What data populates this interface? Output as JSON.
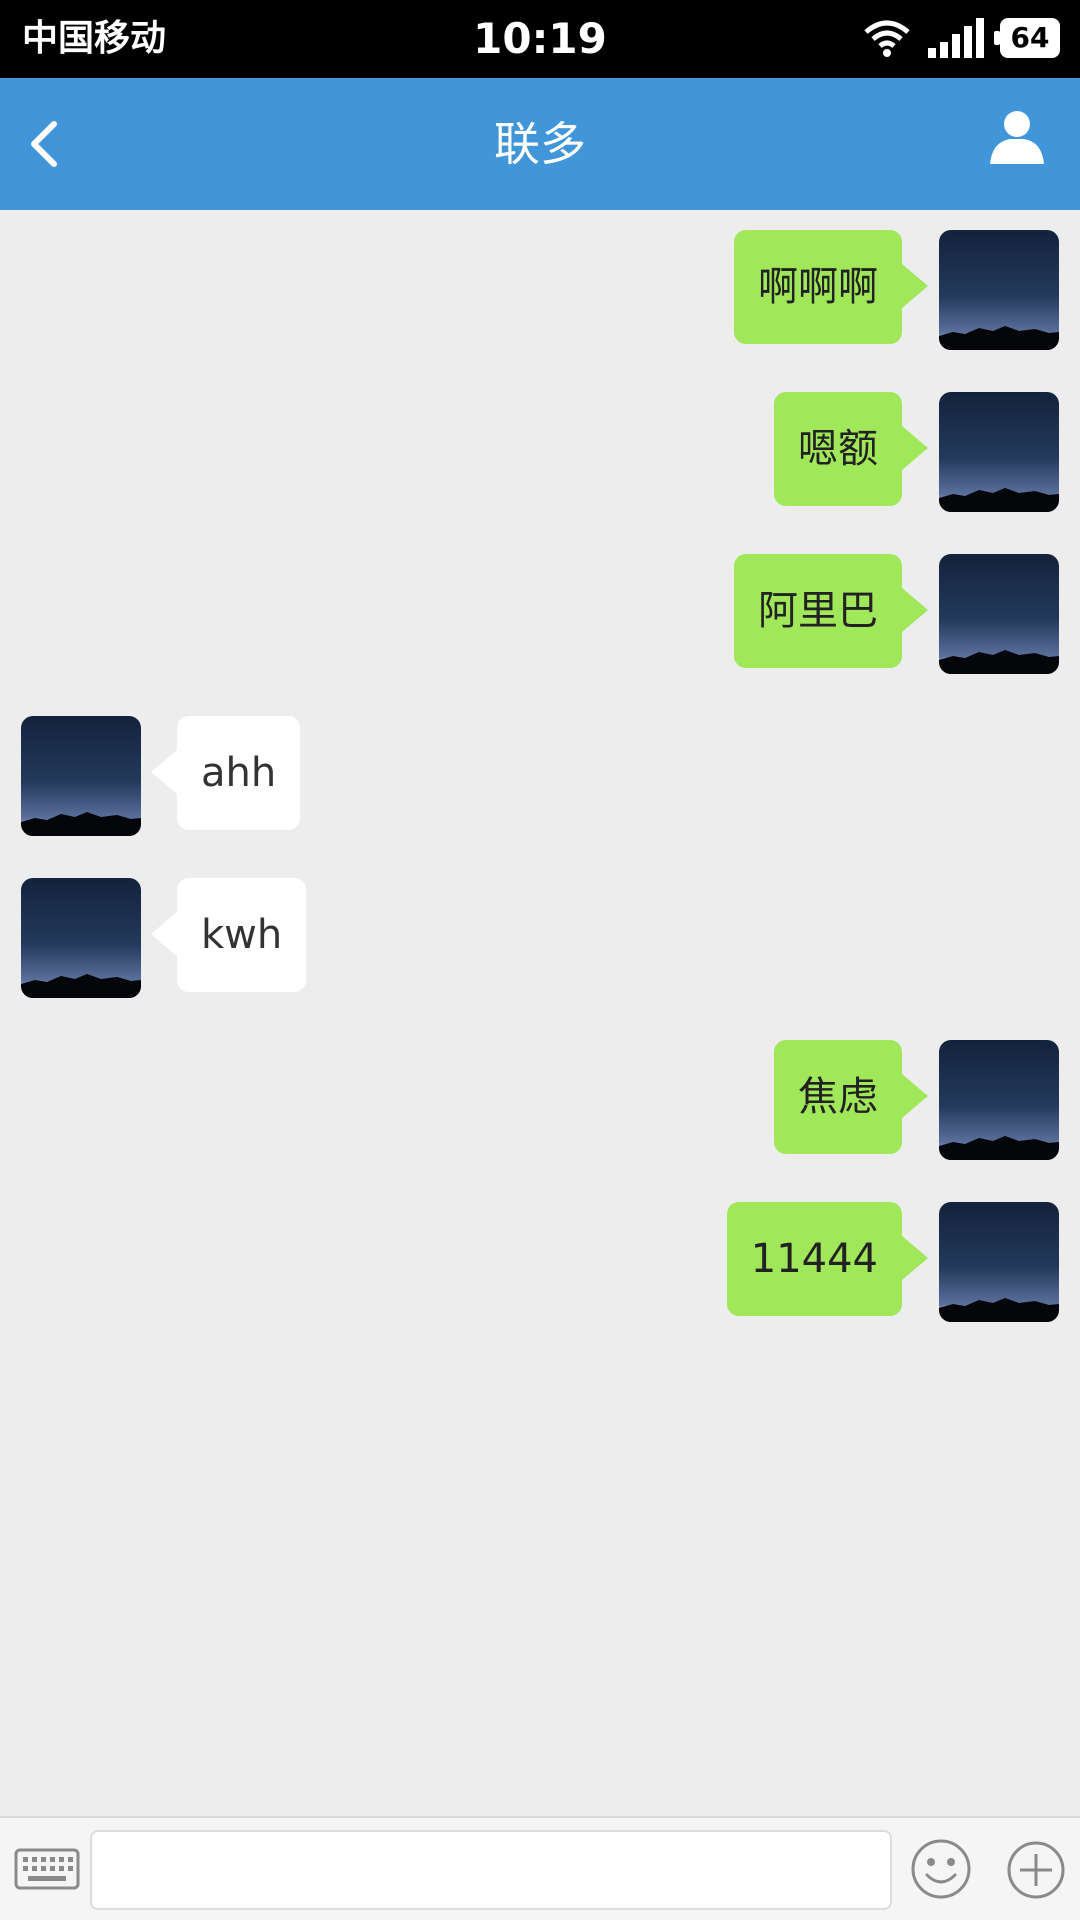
{
  "status_bar": {
    "carrier": "中国移动",
    "time": "10:19",
    "battery": "64"
  },
  "nav": {
    "title": "联多"
  },
  "messages": [
    {
      "side": "sent",
      "text": "啊啊啊"
    },
    {
      "side": "sent",
      "text": "嗯额"
    },
    {
      "side": "sent",
      "text": "阿里巴"
    },
    {
      "side": "recv",
      "text": "ahh"
    },
    {
      "side": "recv",
      "text": "kwh"
    },
    {
      "side": "sent",
      "text": "焦虑"
    },
    {
      "side": "sent",
      "text": "11444"
    }
  ],
  "input": {
    "value": "",
    "placeholder": ""
  },
  "icons": {
    "back": "chevron-left-icon",
    "profile": "user-icon",
    "keyboard": "keyboard-icon",
    "emoji": "smiley-icon",
    "plus": "plus-circle-icon"
  },
  "colors": {
    "nav": "#4096d8",
    "sent_bubble": "#a0e75a",
    "recv_bubble": "#ffffff",
    "background": "#ededed"
  }
}
